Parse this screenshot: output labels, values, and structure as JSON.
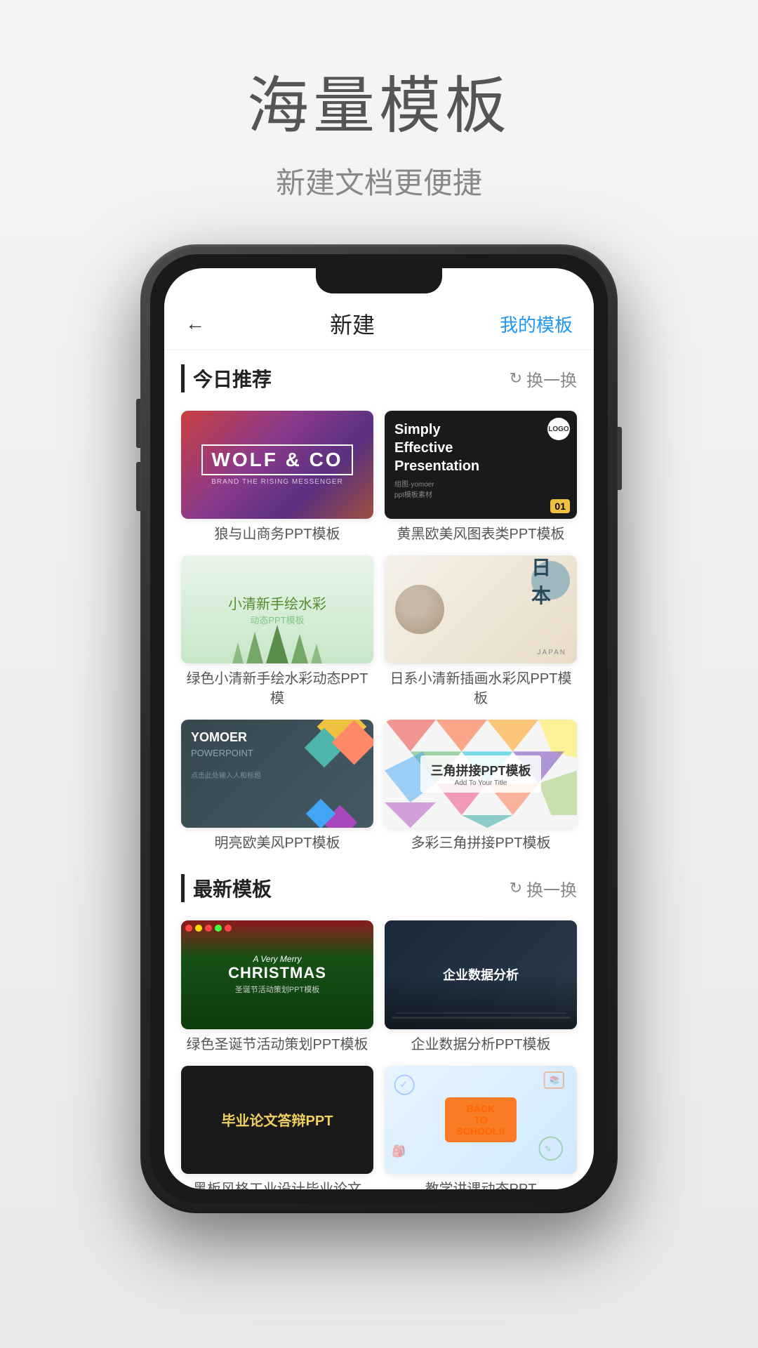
{
  "header": {
    "title": "海量模板",
    "subtitle": "新建文档更便捷"
  },
  "phone": {
    "nav": {
      "back": "←",
      "title": "新建",
      "action": "我的模板"
    },
    "sections": [
      {
        "id": "today",
        "title": "今日推荐",
        "action": "换一换",
        "templates": [
          {
            "id": "wolf",
            "label": "狼与山商务PPT模板",
            "title": "WOLF & CO",
            "subtitle": "BRAND THE RISING MESSENGER"
          },
          {
            "id": "black-yellow",
            "label": "黄黑欧美风图表类PPT模板",
            "title": "Simply\nEffective\nPresentation",
            "logo": "LOGO",
            "num": "01"
          },
          {
            "id": "watercolor",
            "label": "绿色小清新手绘水彩动态PPT模",
            "title": "小清新手绘水彩",
            "subtitle": "动态PPT模板"
          },
          {
            "id": "japan",
            "label": "日系小清新插画水彩风PPT模板",
            "kanji": "日本",
            "text": "JAPAN"
          },
          {
            "id": "yomoer",
            "label": "明亮欧美风PPT模板",
            "brand": "YOMOER",
            "type": "POWERPOINT",
            "tagline": "点击此处输入人和标题"
          },
          {
            "id": "triangle",
            "label": "多彩三角拼接PPT模板",
            "title": "三角拼接PPT模板",
            "subtitle": "Add To Your Title"
          }
        ]
      },
      {
        "id": "latest",
        "title": "最新模板",
        "action": "换一换",
        "templates": [
          {
            "id": "christmas",
            "label": "绿色圣诞节活动策划PPT模板",
            "line1": "A Very Merry",
            "line2": "CHRISTMAS",
            "line3": "圣诞节活动策划PPT模板"
          },
          {
            "id": "enterprise",
            "label": "企业数据分析PPT模板",
            "title": "企业数据分析"
          },
          {
            "id": "graduation",
            "label": "黑板风格工业设计毕业论文答...",
            "title": "毕业论文答辩PPT",
            "subtitle": ""
          },
          {
            "id": "school",
            "label": "教学讲课动态PPT",
            "title": "BACK\nTO\nSCHOOL!!"
          }
        ]
      }
    ]
  }
}
